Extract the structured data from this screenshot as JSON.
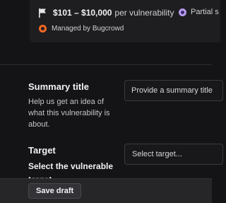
{
  "program_card": {
    "reward_range": "$101 – $10,000",
    "reward_suffix": "per vulnerability",
    "partial_label": "Partial s",
    "managed_label": "Managed by Bugcrowd",
    "icons": {
      "flag": "flag-icon",
      "partial": "partial-safe-harbor-icon",
      "bugcrowd": "bugcrowd-logo-icon"
    },
    "colors": {
      "partial_icon": "#b89cf0",
      "bugcrowd_icon": "#f26822"
    }
  },
  "form": {
    "summary": {
      "title": "Summary title",
      "help": "Help us get an idea of what this vulnerability is about.",
      "placeholder": "Provide a summary title"
    },
    "target": {
      "title": "Target",
      "subtitle_line1": "Select the vulnerable",
      "subtitle_line2": "target",
      "select_placeholder": "Select target..."
    }
  },
  "footer": {
    "save_draft_label": "Save draft"
  }
}
